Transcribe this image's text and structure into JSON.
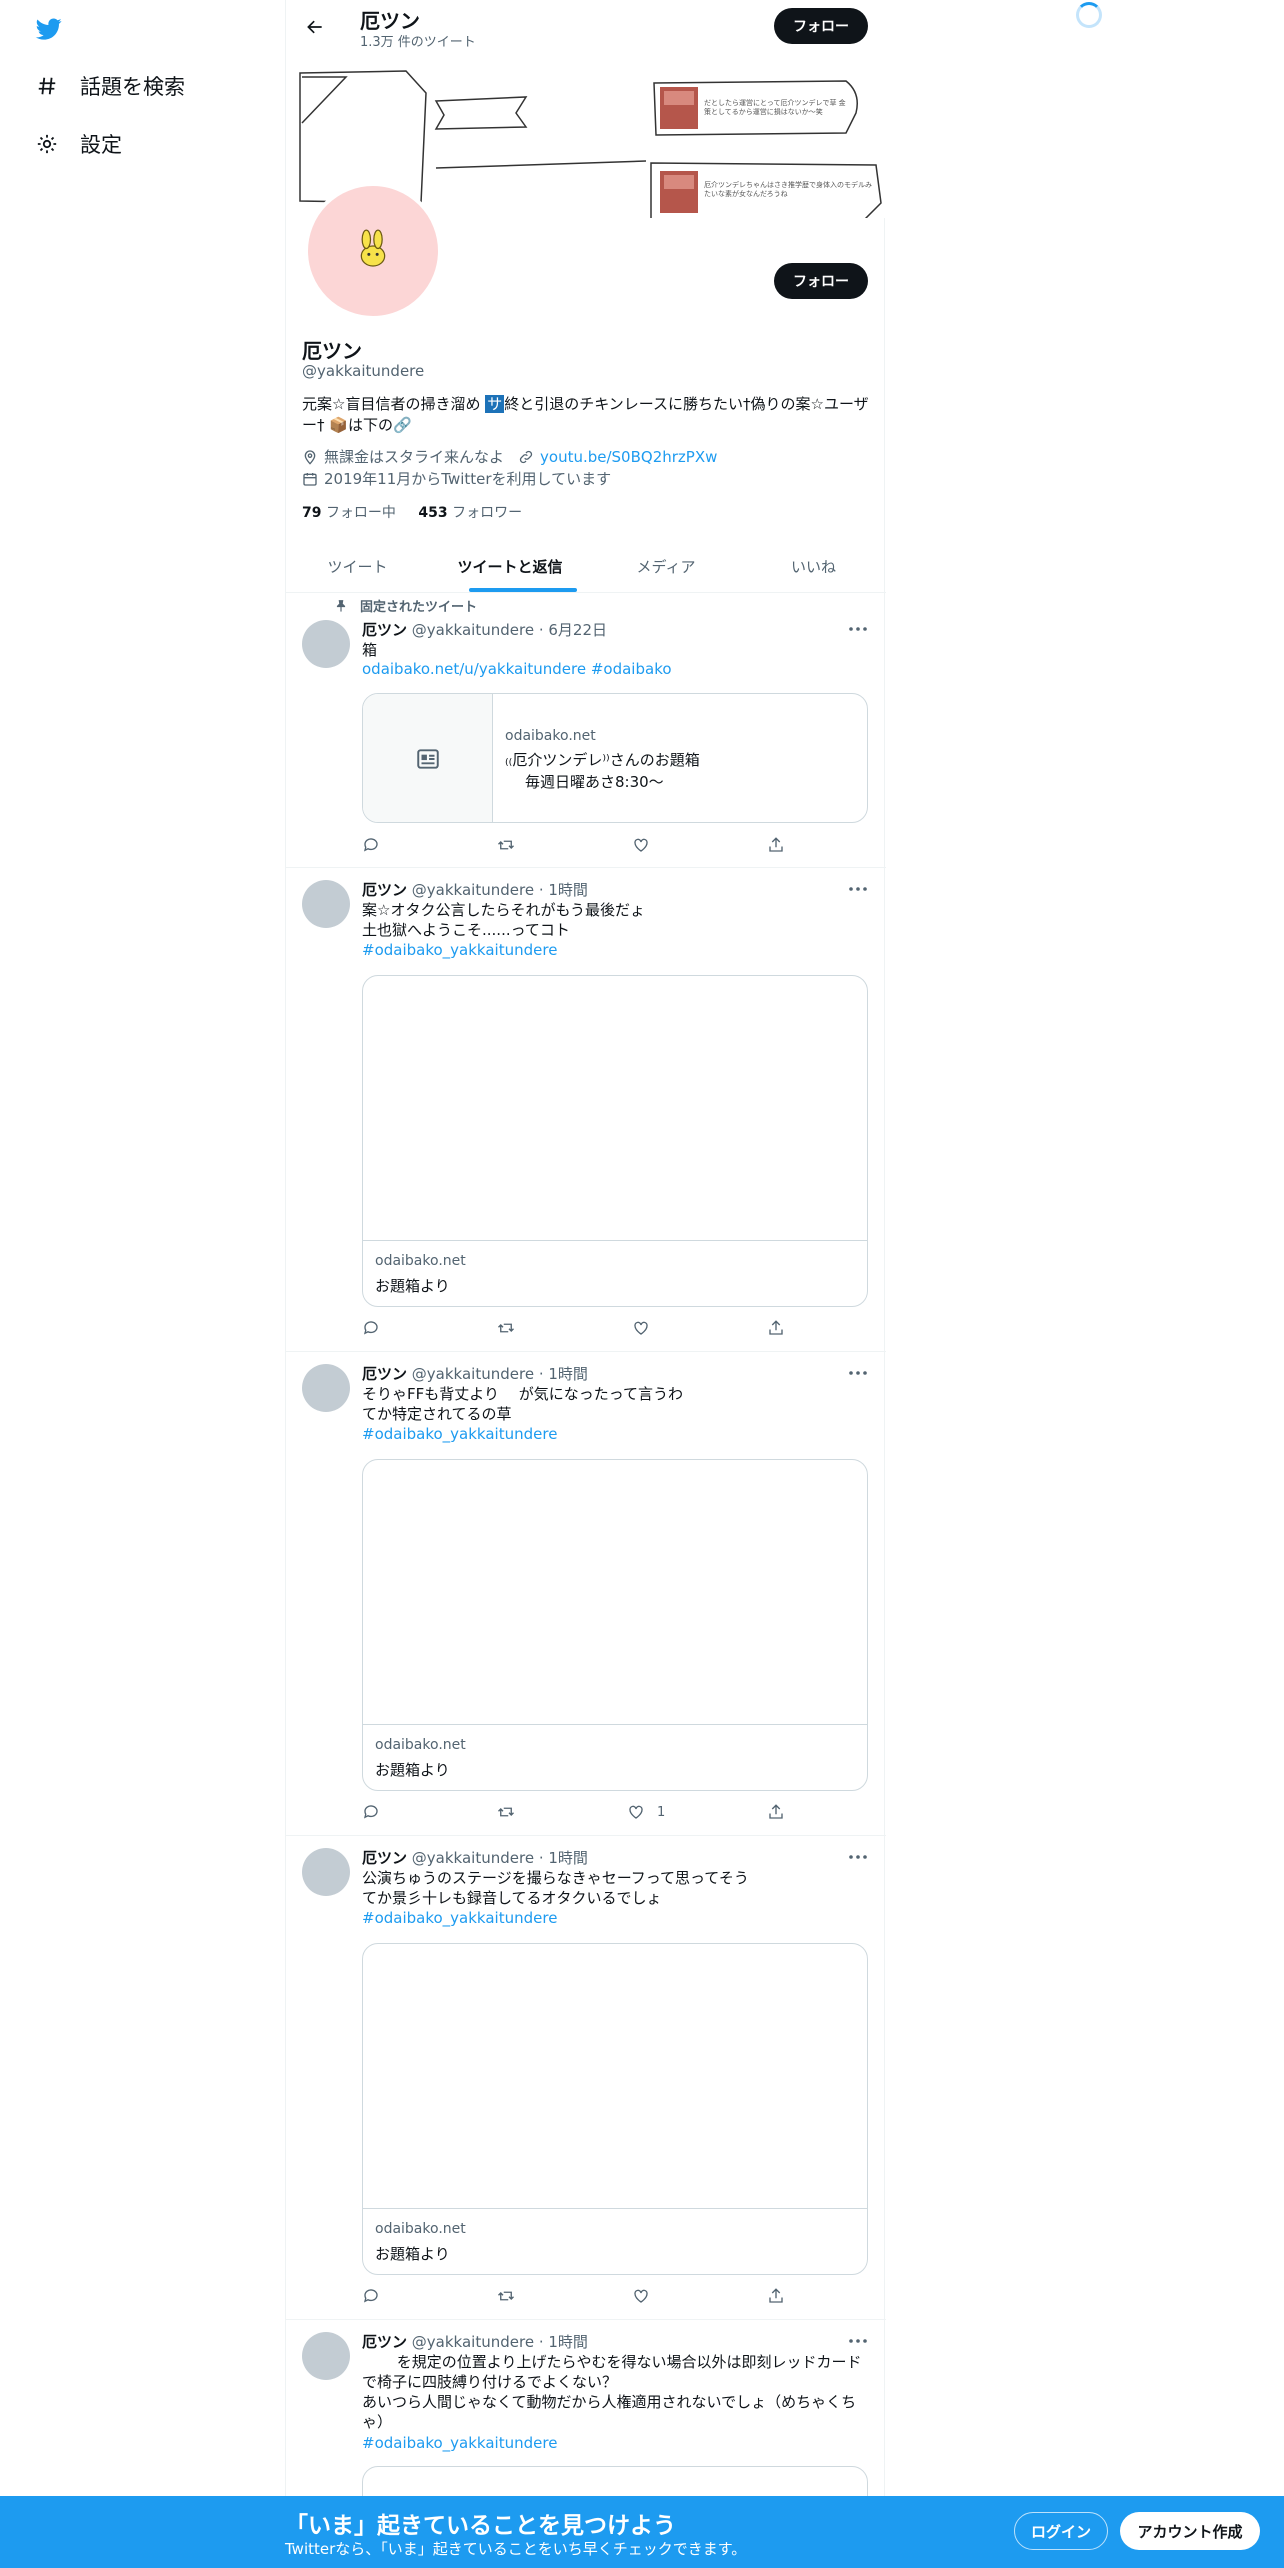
{
  "nav": {
    "items": [
      {
        "label": "話題を検索",
        "icon": "hashtag-icon"
      },
      {
        "label": "設定",
        "icon": "gear-icon"
      }
    ]
  },
  "header": {
    "name": "厄ツン",
    "tweet_count": "1.3万 件のツイート",
    "follow_label": "フォロー"
  },
  "banner": {
    "note1": "だとしたら運営にとって厄介ツンデレで草 金策としてるから運営に損はないか〜笑",
    "note2": "厄介ツンデレちゃんはさき推学歴で身体入のモデルみたいな素が女なんだろうね"
  },
  "profile": {
    "name": "厄ツン",
    "handle": "@yakkaitundere",
    "follow_label": "フォロー",
    "bio_part1": "元案☆盲目信者の掃き溜め ",
    "bio_highlight": "サ",
    "bio_part2": "終と引退のチキンレースに勝ちたい†偽りの案☆ユーザー† 📦は下の🔗",
    "location": "無課金はスタライ来んなよ",
    "link": "youtu.be/S0BQ2hrzPXw",
    "joined": "2019年11月からTwitterを利用しています",
    "following_count": "79",
    "following_label": "フォロー中",
    "followers_count": "453",
    "followers_label": "フォロワー"
  },
  "tabs": [
    {
      "label": "ツイート",
      "active": false
    },
    {
      "label": "ツイートと返信",
      "active": true
    },
    {
      "label": "メディア",
      "active": false
    },
    {
      "label": "いいね",
      "active": false
    }
  ],
  "pinned_label": "固定されたツイート",
  "tweets": [
    {
      "name": "厄ツン",
      "handle": "@yakkaitundere",
      "time": "6月22日",
      "text": "箱",
      "link": "odaibako.net/u/yakkaitundere #odaibako",
      "card": {
        "domain": "odaibako.net",
        "title": "₍₍厄介ツンデレ⁾⁾さんのお題箱",
        "desc": "毎週日曜あさ8:30〜"
      },
      "likes": ""
    },
    {
      "name": "厄ツン",
      "handle": "@yakkaitundere",
      "time": "1時間",
      "text_lines": [
        "案☆オタク公言したらそれがもう最後だょ",
        "土也獄へようこそ......ってコト"
      ],
      "link": "#odaibako_yakkaitundere",
      "card": {
        "domain": "odaibako.net",
        "title": "お題箱より"
      },
      "likes": ""
    },
    {
      "name": "厄ツン",
      "handle": "@yakkaitundere",
      "time": "1時間",
      "text_lines": [
        "そりゃFFも背丈より　 が気になったって言うわ",
        "てか特定されてるの草"
      ],
      "link": "#odaibako_yakkaitundere",
      "card": {
        "domain": "odaibako.net",
        "title": "お題箱より"
      },
      "likes": "1"
    },
    {
      "name": "厄ツン",
      "handle": "@yakkaitundere",
      "time": "1時間",
      "text_lines": [
        "公演ちゅうのステージを撮らなきゃセーフって思ってそう",
        "てか景彡十レも録音してるオタクいるでしょ"
      ],
      "link": "#odaibako_yakkaitundere",
      "card": {
        "domain": "odaibako.net",
        "title": "お題箱より"
      },
      "likes": ""
    },
    {
      "name": "厄ツン",
      "handle": "@yakkaitundere",
      "time": "1時間",
      "text_lines": [
        "　　 を規定の位置より上げたらやむを得ない場合以外は即刻レッドカードで椅子に四肢縛り付けるでよくない？",
        "あいつら人間じゃなくて動物だから人権適用されないでしょ（めちゃくちゃ）"
      ],
      "link": "#odaibako_yakkaitundere"
    }
  ],
  "bottom": {
    "title": "「いま」起きていることを見つけよう",
    "subtitle": "Twitterなら、「いま」起きていることをいち早くチェックできます。",
    "login": "ログイン",
    "signup": "アカウント作成"
  },
  "colors": {
    "accent": "#1d9bf0",
    "dark": "#0f1419",
    "muted": "#536471",
    "avatar_bg": "#fcd6d6"
  }
}
